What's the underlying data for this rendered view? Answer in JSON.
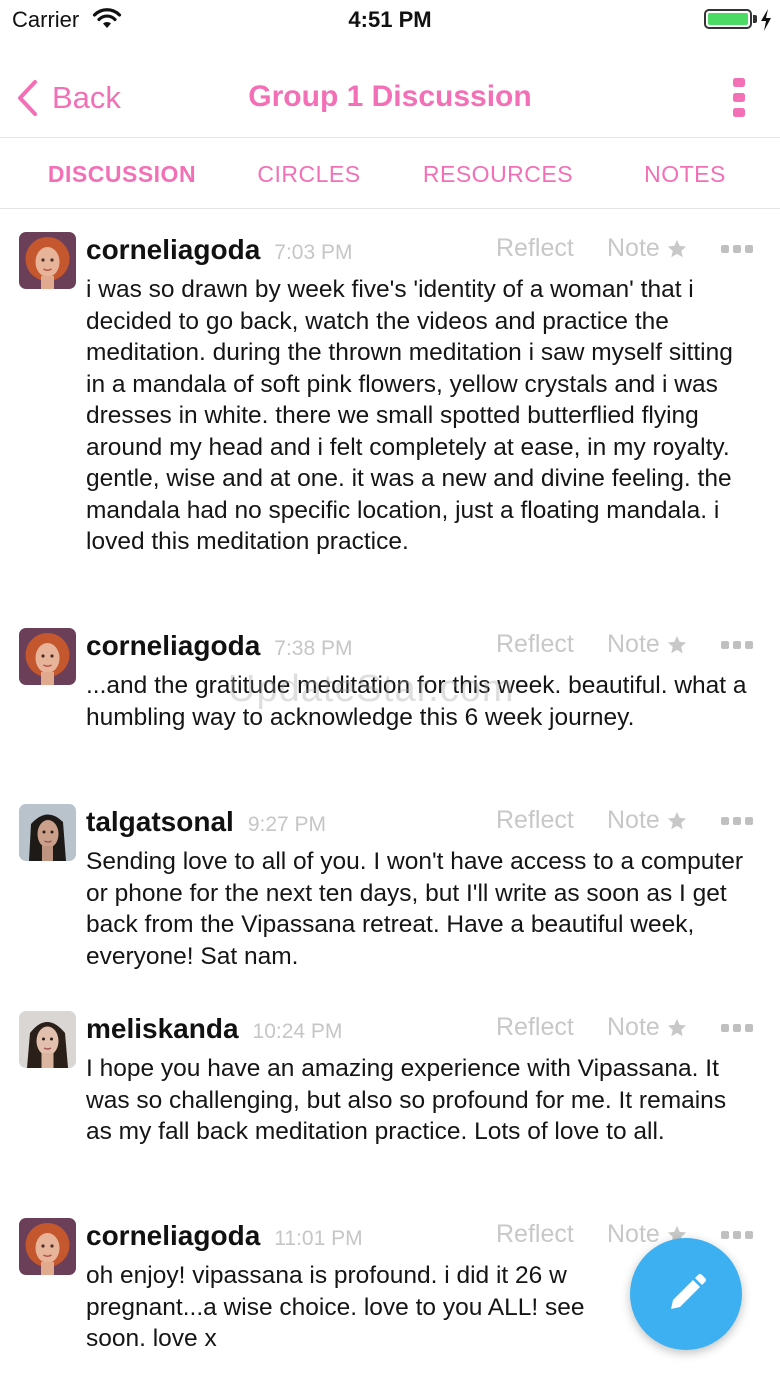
{
  "status_bar": {
    "carrier": "Carrier",
    "time": "4:51 PM",
    "battery_color": "#4cd964"
  },
  "nav": {
    "back_label": "Back",
    "title": "Group 1 Discussion",
    "accent_color": "#f36fb6"
  },
  "tabs": [
    {
      "label": "DISCUSSION",
      "active": true
    },
    {
      "label": "CIRCLES",
      "active": false
    },
    {
      "label": "RESOURCES",
      "active": false
    },
    {
      "label": "NOTES",
      "active": false
    }
  ],
  "posts": [
    {
      "username": "corneliagoda",
      "time": "7:03 PM",
      "reflect_label": "Reflect",
      "note_label": "Note",
      "avatar": "redhead-woman-avatar",
      "body": "i was so drawn by week five's 'identity of a woman' that i decided to go back, watch the videos and practice the meditation. during the thrown meditation i saw myself sitting in a mandala of soft pink flowers, yellow crystals and i was dresses in white. there we small spotted butterflied flying around my head and i felt completely at ease, in my royalty. gentle, wise and at one. it was a new and divine feeling. the mandala had no specific location, just a floating mandala. i loved this meditation practice."
    },
    {
      "username": "corneliagoda",
      "time": "7:38 PM",
      "reflect_label": "Reflect",
      "note_label": "Note",
      "avatar": "redhead-woman-avatar",
      "body": "...and the gratitude meditation for this week. beautiful. what a humbling way to acknowledge this 6 week journey."
    },
    {
      "username": "talgatsonal",
      "time": "9:27 PM",
      "reflect_label": "Reflect",
      "note_label": "Note",
      "avatar": "dark-hair-woman-avatar",
      "body": "Sending love to all of you. I won't have access to a computer or phone for the next ten days, but I'll write as soon as I get back from the Vipassana retreat. Have a beautiful week, everyone! Sat nam."
    },
    {
      "username": "meliskanda",
      "time": "10:24 PM",
      "reflect_label": "Reflect",
      "note_label": "Note",
      "avatar": "brunette-woman-avatar",
      "body": "I hope you have an amazing experience with Vipassana. It was so challenging, but also so profound for me. It remains as my fall back meditation practice. Lots of love to all."
    },
    {
      "username": "corneliagoda",
      "time": "11:01 PM",
      "reflect_label": "Reflect",
      "note_label": "Note",
      "avatar": "redhead-woman-avatar",
      "body": " oh enjoy! vipassana is profound. i did it 26 w pregnant...a wise choice. love to you ALL! see soon. love x"
    }
  ],
  "watermark": "UpdateStar.com",
  "fab": {
    "icon": "pencil-icon",
    "color": "#3db0f1"
  }
}
